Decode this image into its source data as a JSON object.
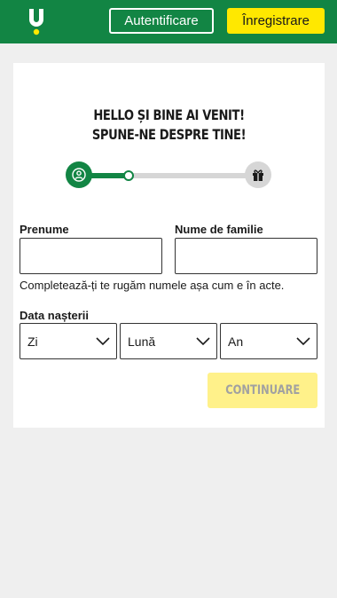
{
  "header": {
    "logo_icon": "unibet-logo-icon",
    "login_label": "Autentificare",
    "register_label": "Înregistrare",
    "brand_color": "#128544",
    "accent_color": "#ffe800"
  },
  "form": {
    "title_line1": "HELLO ȘI BINE AI VENIT!",
    "title_line2": "SPUNE-NE DESPRE TINE!",
    "progress": {
      "fraction": 0.29,
      "steps": [
        "user-icon",
        "gift-icon"
      ]
    },
    "first_name_label": "Prenume",
    "first_name_value": "",
    "last_name_label": "Nume de familie",
    "last_name_value": "",
    "name_hint": "Completează-ți te rugăm numele așa cum e în acte.",
    "dob_label": "Data nașterii",
    "day_selected": "Zi",
    "month_selected": "Lună",
    "year_selected": "An",
    "continue_label": "CONTINUARE"
  }
}
